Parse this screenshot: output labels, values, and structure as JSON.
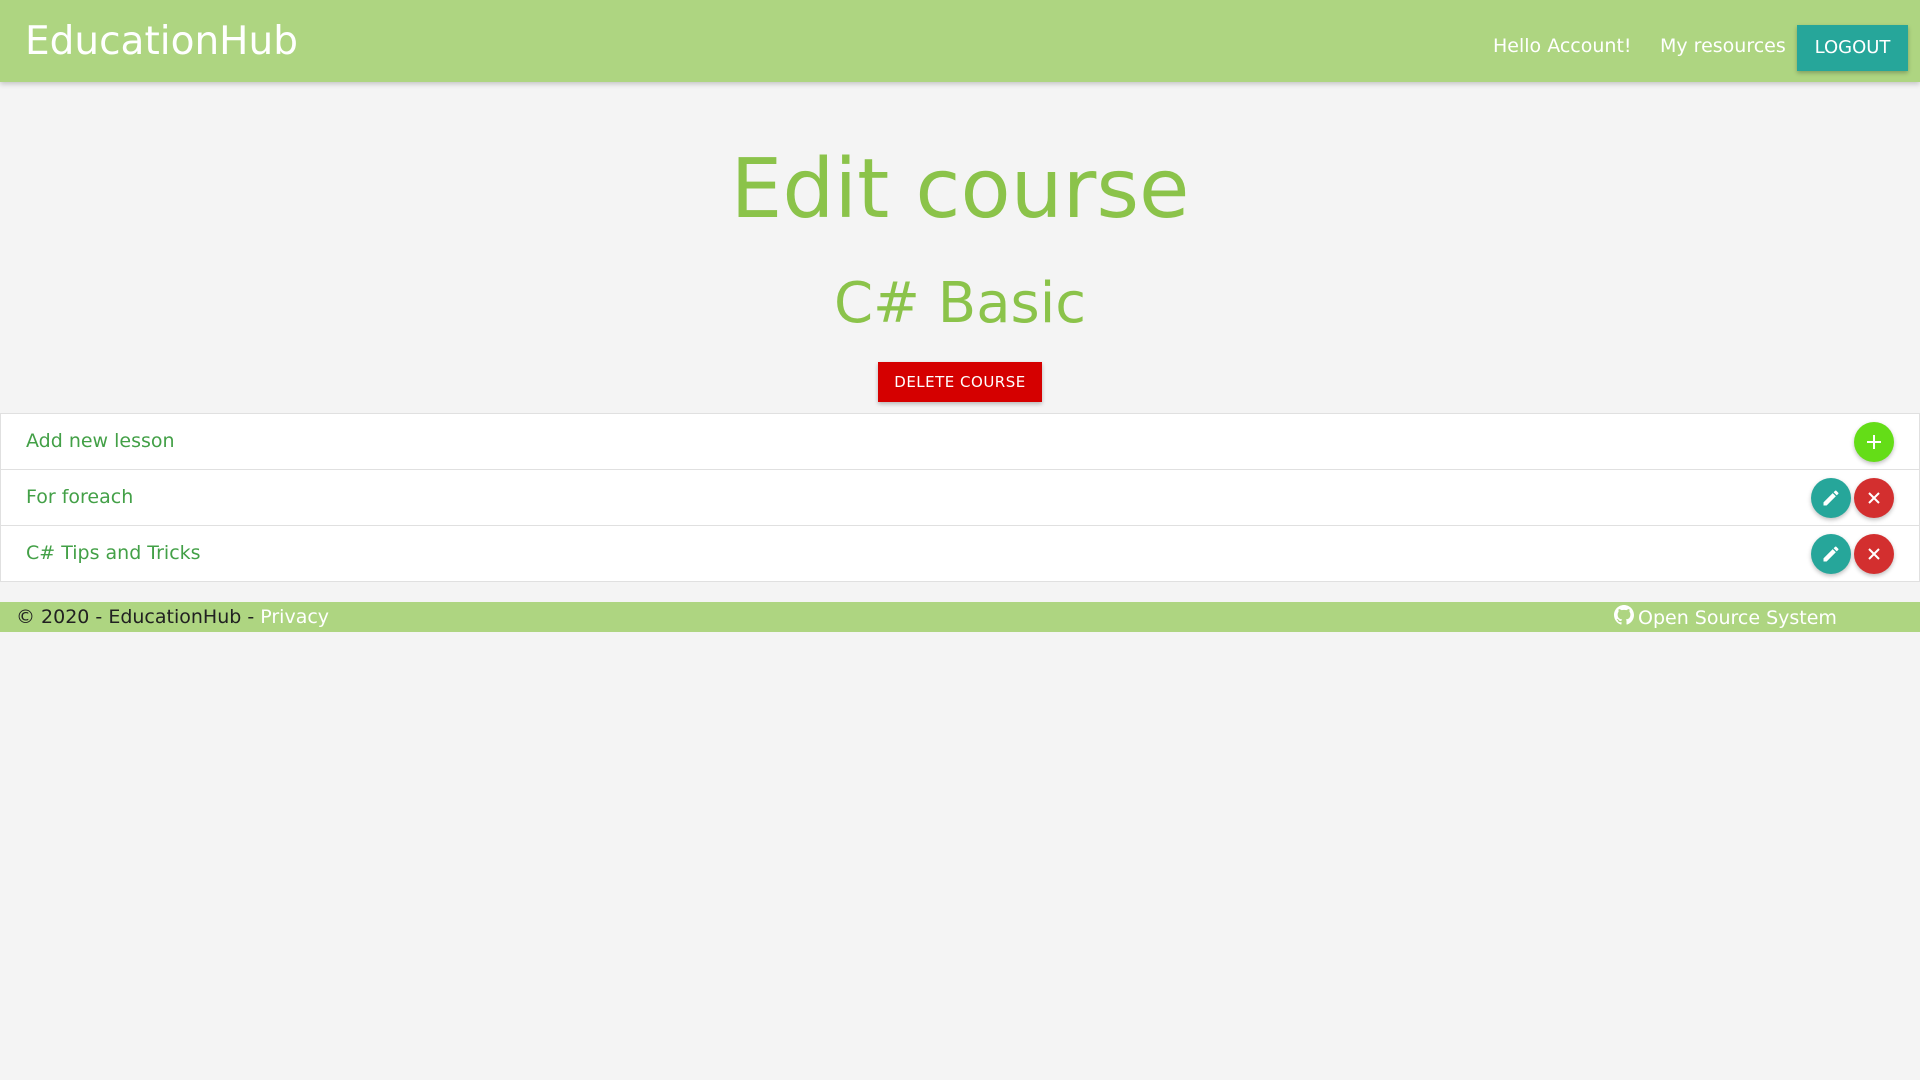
{
  "navbar": {
    "brand": "EducationHub",
    "greeting": "Hello Account!",
    "resources_link": "My resources",
    "logout_label": "LOGOUT"
  },
  "main": {
    "title": "Edit course",
    "course_name": "C# Basic",
    "delete_course_label": "DELETE COURSE"
  },
  "lessons": {
    "add_label": "Add new lesson",
    "items": [
      {
        "label": "For foreach"
      },
      {
        "label": "C# Tips and Tricks"
      }
    ]
  },
  "footer": {
    "copyright": "© 2020 - EducationHub - ",
    "privacy_link": "Privacy",
    "open_source_link": "Open Source System"
  },
  "icons": {
    "add": "plus-icon",
    "edit": "pencil-icon",
    "delete": "close-icon",
    "github": "github-icon"
  },
  "colors": {
    "navbar_bg": "#aed581",
    "accent_green": "#8bc34a",
    "teal": "#26a69a",
    "danger_red": "#d50000"
  }
}
